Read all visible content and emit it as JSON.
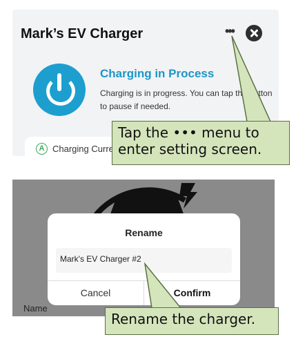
{
  "charger_panel": {
    "title": "Mark’s EV Charger",
    "status_title": "Charging in Process",
    "status_desc": "Charging is in progress. You can tap the button to pause if needed.",
    "current_icon_letter": "A",
    "current_label": "Charging Current"
  },
  "rename_dialog": {
    "title": "Rename",
    "input_value": "Mark's EV Charger #2",
    "cancel_label": "Cancel",
    "confirm_label": "Confirm",
    "background_label": "Name"
  },
  "callouts": {
    "menu_tip_line1": "Tap the ••• menu to",
    "menu_tip_line2": "enter setting screen.",
    "rename_tip": "Rename the charger."
  },
  "colors": {
    "accent_blue": "#1c9fcf",
    "callout_green": "#d4e5bb",
    "dialog_overlay": "#8a8a8a"
  }
}
